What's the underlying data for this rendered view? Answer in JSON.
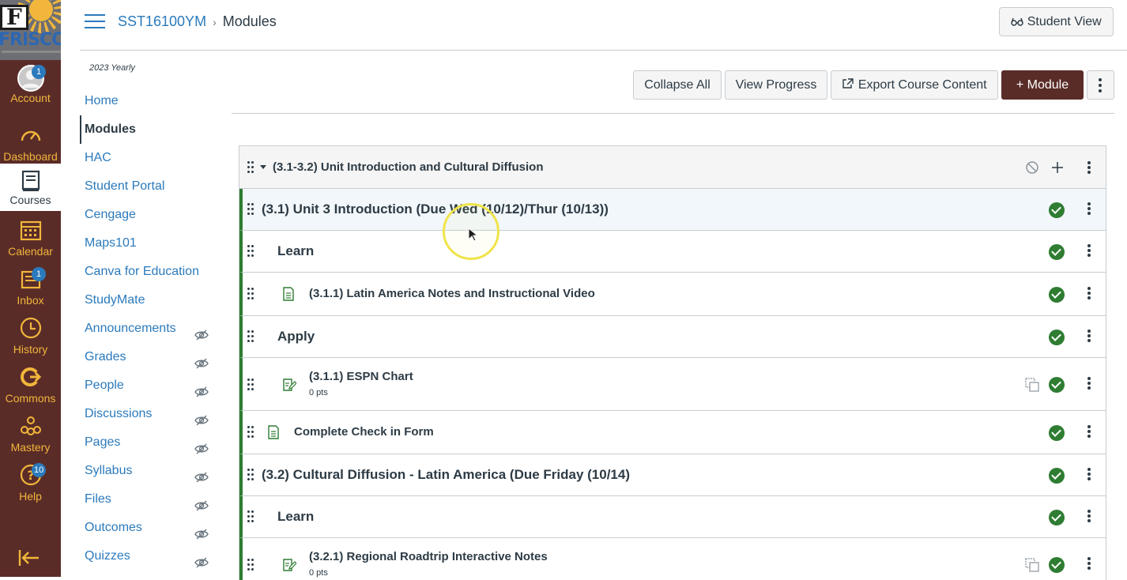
{
  "global_nav": {
    "logo_text": "FRISCO",
    "items": [
      {
        "id": "account",
        "label": "Account",
        "icon": "avatar-icon",
        "badge": "1"
      },
      {
        "id": "dashboard",
        "label": "Dashboard",
        "icon": "dashboard-icon",
        "badge": ""
      },
      {
        "id": "courses",
        "label": "Courses",
        "icon": "courses-icon",
        "badge": ""
      },
      {
        "id": "calendar",
        "label": "Calendar",
        "icon": "calendar-icon",
        "badge": ""
      },
      {
        "id": "inbox",
        "label": "Inbox",
        "icon": "inbox-icon",
        "badge": "1"
      },
      {
        "id": "history",
        "label": "History",
        "icon": "history-icon",
        "badge": ""
      },
      {
        "id": "commons",
        "label": "Commons",
        "icon": "commons-icon",
        "badge": ""
      },
      {
        "id": "mastery",
        "label": "Mastery",
        "icon": "mastery-icon",
        "badge": ""
      },
      {
        "id": "help",
        "label": "Help",
        "icon": "help-icon",
        "badge": "10"
      }
    ]
  },
  "header": {
    "course": "SST16100YM",
    "separator": "›",
    "page": "Modules",
    "student_view": "Student View"
  },
  "course_nav": {
    "term": "2023 Yearly",
    "items": [
      {
        "label": "Home",
        "hidden": false
      },
      {
        "label": "Modules",
        "hidden": false
      },
      {
        "label": "HAC",
        "hidden": false
      },
      {
        "label": "Student Portal",
        "hidden": false
      },
      {
        "label": "Cengage",
        "hidden": false
      },
      {
        "label": "Maps101",
        "hidden": false
      },
      {
        "label": "Canva for Education",
        "hidden": false
      },
      {
        "label": "StudyMate",
        "hidden": false
      },
      {
        "label": "Announcements",
        "hidden": true
      },
      {
        "label": "Grades",
        "hidden": true
      },
      {
        "label": "People",
        "hidden": true
      },
      {
        "label": "Discussions",
        "hidden": true
      },
      {
        "label": "Pages",
        "hidden": true
      },
      {
        "label": "Syllabus",
        "hidden": true
      },
      {
        "label": "Files",
        "hidden": true
      },
      {
        "label": "Outcomes",
        "hidden": true
      },
      {
        "label": "Quizzes",
        "hidden": true
      }
    ]
  },
  "toolbar": {
    "collapse_all": "Collapse All",
    "view_progress": "View Progress",
    "export": "Export Course Content",
    "add_module": "Module",
    "add_module_prefix": "+"
  },
  "module": {
    "title": "(3.1-3.2) Unit Introduction and Cultural Diffusion",
    "rows": [
      {
        "type": "subheader",
        "title": "(3.1) Unit 3 Introduction (Due Wed (10/12)/Thur (10/13))"
      },
      {
        "type": "section",
        "title": "Learn"
      },
      {
        "type": "page",
        "title": "(3.1.1) Latin America Notes and Instructional Video"
      },
      {
        "type": "section",
        "title": "Apply"
      },
      {
        "type": "assignment",
        "title": "(3.1.1) ESPN Chart",
        "pts": "0 pts"
      },
      {
        "type": "page",
        "title": "Complete Check in Form"
      },
      {
        "type": "subheader",
        "title": "(3.2) Cultural Diffusion - Latin America (Due Friday (10/14)"
      },
      {
        "type": "section",
        "title": "Learn"
      },
      {
        "type": "assignment",
        "title": "(3.2.1) Regional Roadtrip Interactive Notes",
        "pts": "0 pts"
      }
    ]
  },
  "colors": {
    "nav_bg": "#5a2c28",
    "nav_accent": "#f1b63b",
    "link": "#2b7abc",
    "published": "#2e7d32",
    "module_border": "#2e7d32"
  }
}
